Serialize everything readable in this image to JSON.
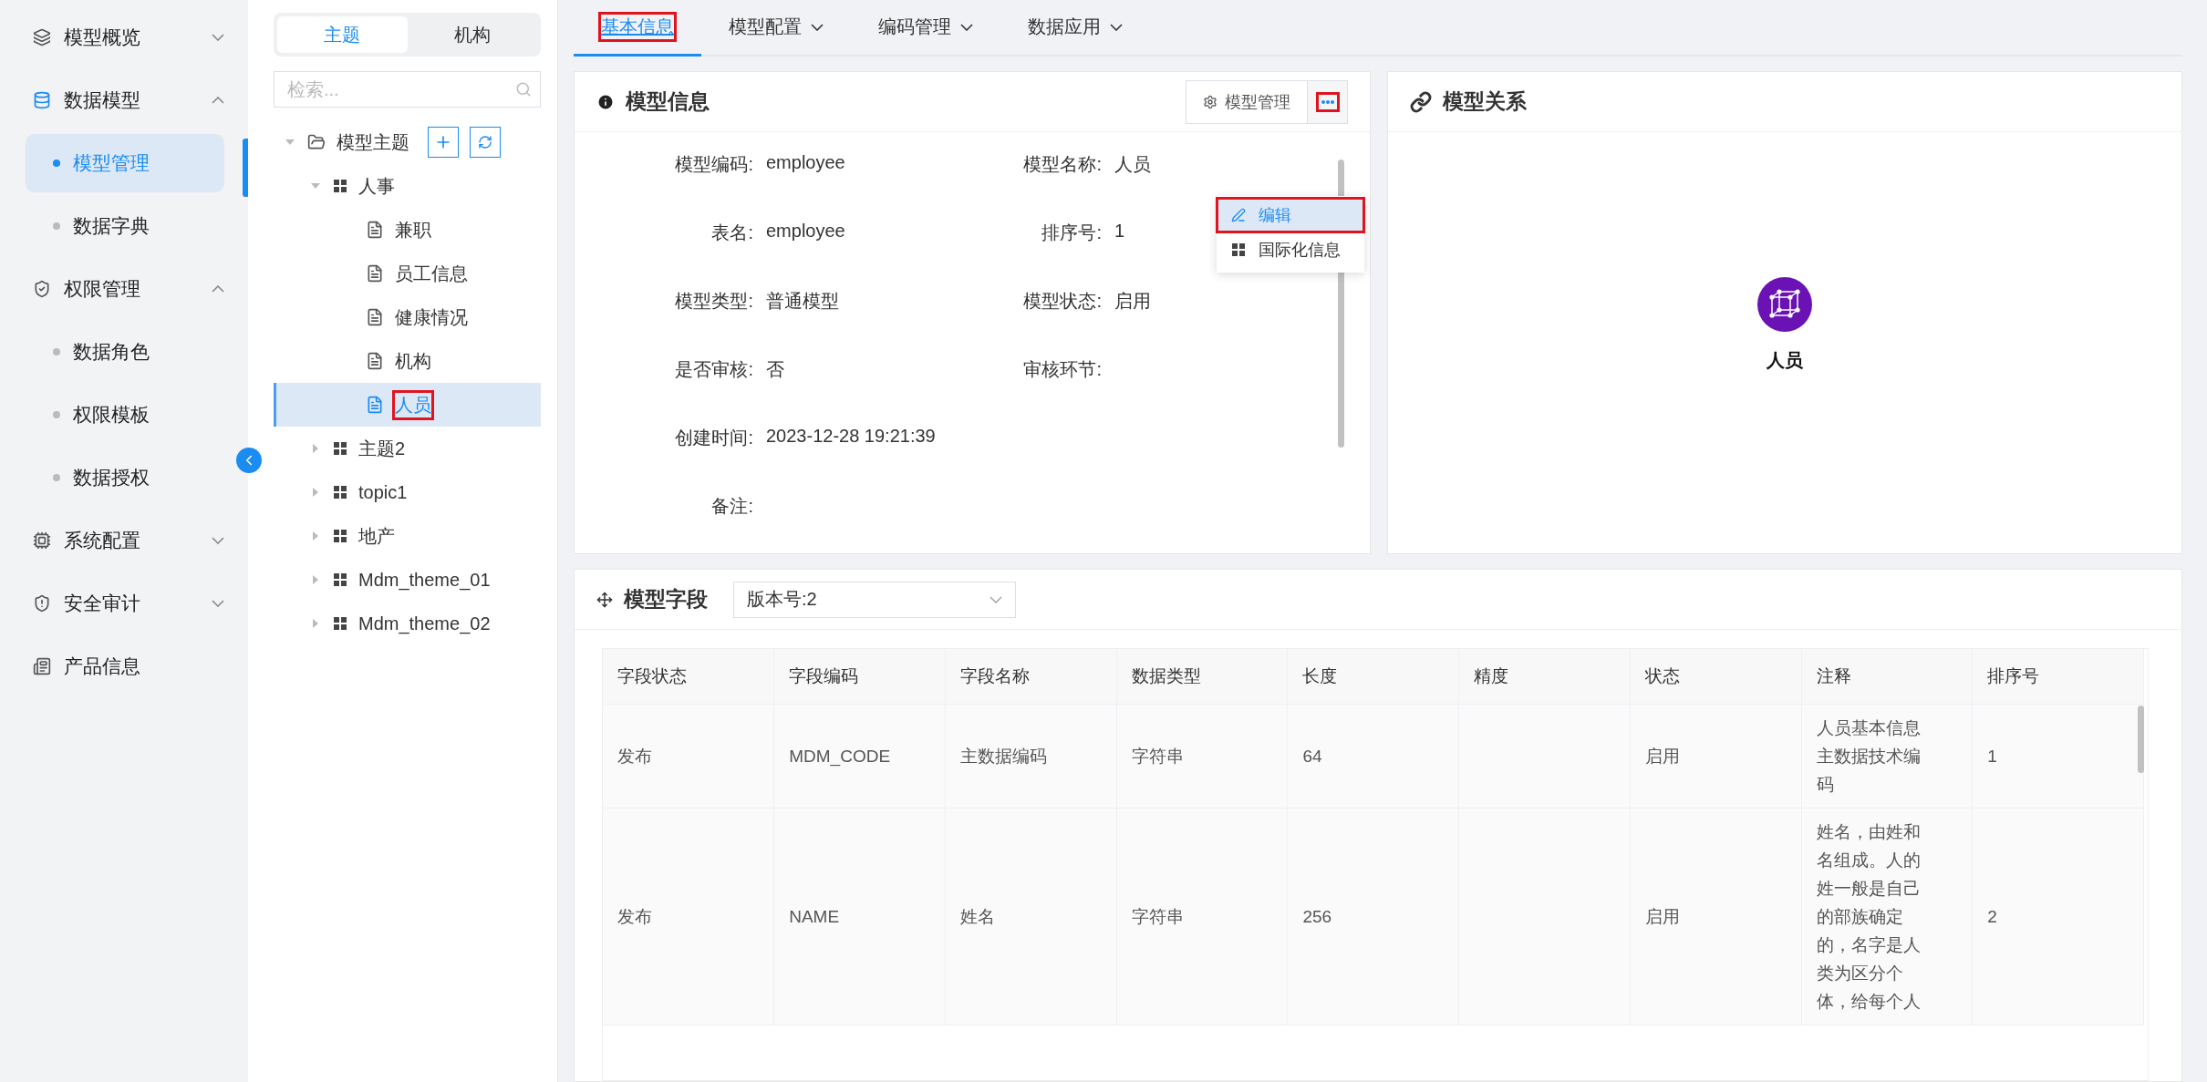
{
  "sidebar": {
    "items": [
      {
        "label": "模型概览",
        "selected": false,
        "expanded": false
      },
      {
        "label": "数据模型",
        "selected": true,
        "expanded": true,
        "children": [
          {
            "label": "模型管理",
            "selected": true
          },
          {
            "label": "数据字典",
            "selected": false
          }
        ]
      },
      {
        "label": "权限管理",
        "selected": false,
        "expanded": true,
        "children": [
          {
            "label": "数据角色",
            "selected": false
          },
          {
            "label": "权限模板",
            "selected": false
          },
          {
            "label": "数据授权",
            "selected": false
          }
        ]
      },
      {
        "label": "系统配置",
        "selected": false,
        "expanded": false
      },
      {
        "label": "安全审计",
        "selected": false,
        "expanded": false
      },
      {
        "label": "产品信息",
        "selected": false
      }
    ]
  },
  "tree": {
    "tabs": [
      {
        "label": "主题",
        "selected": true
      },
      {
        "label": "机构",
        "selected": false
      }
    ],
    "search": {
      "placeholder": "检索..."
    },
    "root": {
      "label": "模型主题",
      "expanded": true,
      "selected": false,
      "children": [
        {
          "label": "人事",
          "expanded": true,
          "selected": false,
          "children": [
            {
              "label": "兼职",
              "selected": false
            },
            {
              "label": "员工信息",
              "selected": false
            },
            {
              "label": "健康情况",
              "selected": false
            },
            {
              "label": "机构",
              "selected": false
            },
            {
              "label": "人员",
              "selected": true
            }
          ]
        },
        {
          "label": "主题2",
          "expanded": false,
          "selected": false
        },
        {
          "label": "topic1",
          "expanded": false,
          "selected": false
        },
        {
          "label": "地产",
          "expanded": false,
          "selected": false
        },
        {
          "label": "Mdm_theme_01",
          "expanded": false,
          "selected": false
        },
        {
          "label": "Mdm_theme_02",
          "expanded": false,
          "selected": false
        }
      ]
    }
  },
  "tabs": [
    {
      "label": "基本信息",
      "selected": true,
      "dropdown": false
    },
    {
      "label": "模型配置",
      "selected": false,
      "dropdown": true
    },
    {
      "label": "编码管理",
      "selected": false,
      "dropdown": true
    },
    {
      "label": "数据应用",
      "selected": false,
      "dropdown": true
    }
  ],
  "model_info": {
    "title": "模型信息",
    "manage_button": "模型管理",
    "menu": [
      {
        "label": "编辑",
        "selected": true
      },
      {
        "label": "国际化信息",
        "selected": false
      }
    ],
    "field_rows": [
      [
        {
          "label": "模型编码:",
          "value": "employee"
        },
        {
          "label": "模型名称:",
          "value": "人员"
        }
      ],
      [
        {
          "label": "表名:",
          "value": "employee"
        },
        {
          "label": "排序号:",
          "value": "1"
        }
      ],
      [
        {
          "label": "模型类型:",
          "value": "普通模型"
        },
        {
          "label": "模型状态:",
          "value": "启用"
        }
      ],
      [
        {
          "label": "是否审核:",
          "value": "否"
        },
        {
          "label": "审核环节:"
        }
      ],
      [
        {
          "label": "创建时间:",
          "value": "2023-12-28 19:21:39"
        }
      ],
      [
        {
          "label": "备注:"
        }
      ]
    ]
  },
  "model_relation": {
    "title": "模型关系",
    "node": "人员"
  },
  "model_fields": {
    "title": "模型字段",
    "version": "版本号:2",
    "table": {
      "columns": [
        "字段状态",
        "字段编码",
        "字段名称",
        "数据类型",
        "长度",
        "精度",
        "状态",
        "注释",
        "排序号"
      ],
      "rows": [
        [
          "发布",
          "MDM_CODE",
          "主数据编码",
          "字符串",
          "64",
          "",
          "启用",
          "人员基本信息主数据技术编码",
          "1"
        ],
        [
          "发布",
          "NAME",
          "姓名",
          "字符串",
          "256",
          "",
          "启用",
          "姓名，由姓和名组成。人的姓一般是自己的部族确定的，名字是人类为区分个体，给每个人",
          "2"
        ]
      ]
    }
  }
}
